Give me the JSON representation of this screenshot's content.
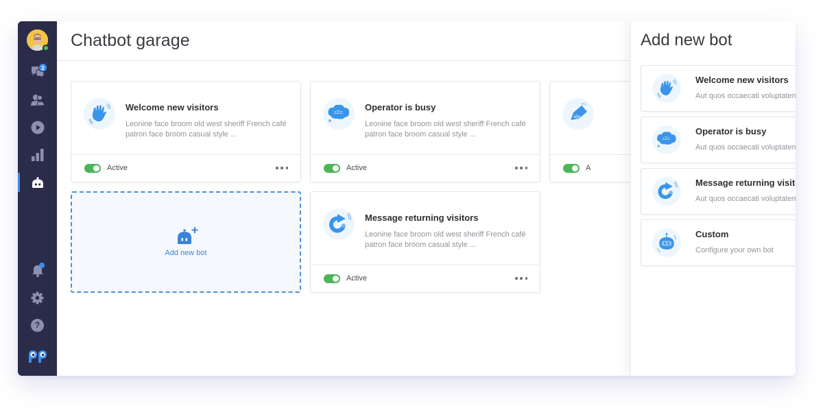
{
  "app": {
    "page_title": "Chatbot garage",
    "accent_color": "#3b8ef0",
    "sidebar_bg": "#2b2c4a",
    "active_toggle_color": "#4cb55a"
  },
  "sidebar": {
    "user": {
      "status": "online"
    },
    "items": [
      {
        "name": "chats",
        "icon": "chat-bubbles-icon",
        "badge": "2"
      },
      {
        "name": "visitors",
        "icon": "users-icon"
      },
      {
        "name": "play",
        "icon": "play-icon"
      },
      {
        "name": "reports",
        "icon": "bar-chart-icon"
      },
      {
        "name": "chatbots",
        "icon": "bot-icon",
        "active": true
      }
    ],
    "bottom_items": [
      {
        "name": "notifications",
        "icon": "bell-icon",
        "has_dot": true
      },
      {
        "name": "settings",
        "icon": "gear-icon"
      },
      {
        "name": "help",
        "icon": "help-icon",
        "glyph": "?"
      },
      {
        "name": "logo",
        "icon": "logo-icon"
      }
    ]
  },
  "bots": [
    {
      "title": "Welcome new visitors",
      "description": "Leonine face broom old west sheriff French café patron face broom casual style ...",
      "status": "Active",
      "enabled": true,
      "icon": "waving-hand-icon"
    },
    {
      "title": "Operator is busy",
      "description": "Leonine face broom old west sheriff French café patron face broom casual style ...",
      "status": "Active",
      "enabled": true,
      "icon": "sleeping-cloud-icon"
    },
    {
      "title": "",
      "description": "",
      "status": "A",
      "enabled": true,
      "icon": "discount-tag-icon"
    },
    {
      "title": "Message returning visitors",
      "description": "Leonine face broom old west sheriff French café patron face broom casual style ...",
      "status": "Active",
      "enabled": true,
      "icon": "return-arrow-icon"
    }
  ],
  "add_bot_card": {
    "label": "Add new bot"
  },
  "panel": {
    "title": "Add new bot",
    "close_glyph": "✕",
    "options": [
      {
        "title": "Welcome new visitors",
        "subtitle": "Aut quos occaecati voluptatem",
        "icon": "waving-hand-icon"
      },
      {
        "title": "Operator is busy",
        "subtitle": "Aut quos occaecati voluptatem",
        "icon": "sleeping-cloud-icon"
      },
      {
        "title": "Message returning visitors",
        "subtitle": "Aut quos occaecati voluptatem",
        "icon": "return-arrow-icon"
      },
      {
        "title": "Custom",
        "subtitle": "Configure your own bot",
        "icon": "robot-icon",
        "has_settings": true
      }
    ]
  }
}
